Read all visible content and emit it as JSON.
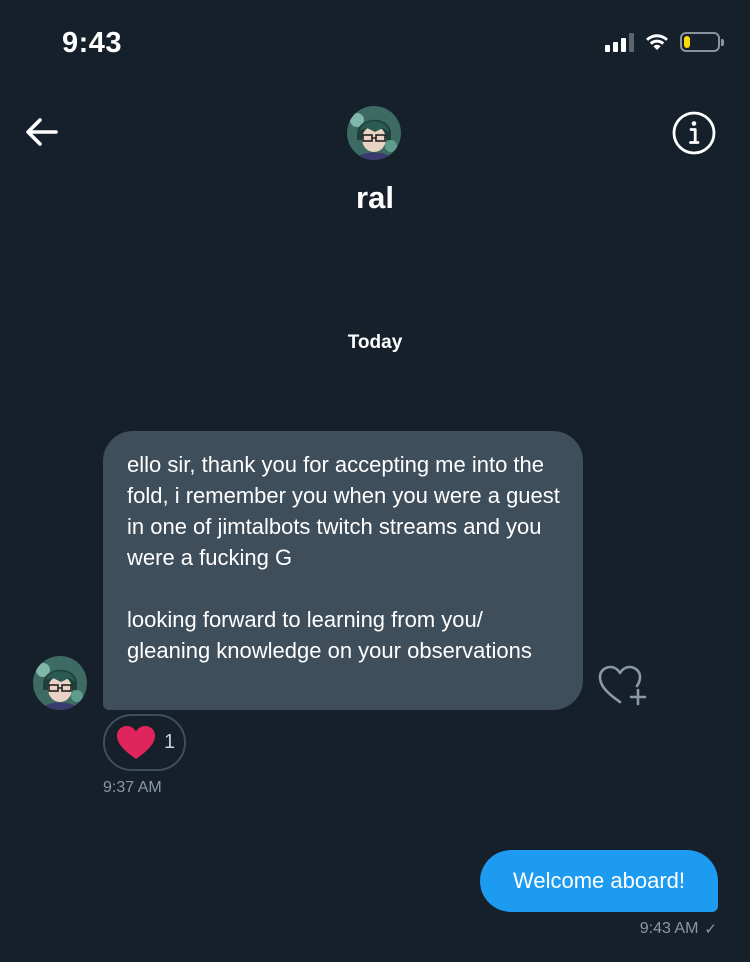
{
  "status_bar": {
    "time": "9:43",
    "battery_level": 0.2,
    "battery_color": "#ffd60a"
  },
  "header": {
    "back_icon": "arrow-left-icon",
    "info_icon": "info-icon",
    "contact_name": "ral"
  },
  "conversation": {
    "date_divider": "Today",
    "received_message": {
      "paragraphs": [
        "ello sir, thank you for accepting me into the fold, i remember you when you were a guest in one of jimtalbots twitch streams and you were a fucking G",
        "looking forward to learning from you/ gleaning knowledge on your observations"
      ],
      "timestamp": "9:37 AM",
      "reaction": {
        "icon": "heart-icon",
        "count": "1",
        "color": "#e0245e"
      },
      "like_icon": "heart-plus-icon"
    },
    "sent_message": {
      "text": "Welcome aboard!",
      "timestamp": "9:43 AM",
      "status_icon": "checkmark-icon",
      "status_glyph": "✓"
    }
  },
  "colors": {
    "background": "#15202b",
    "received_bubble": "#3f4e5b",
    "sent_bubble": "#1d9bf0",
    "secondary_text": "#8b98a5"
  }
}
